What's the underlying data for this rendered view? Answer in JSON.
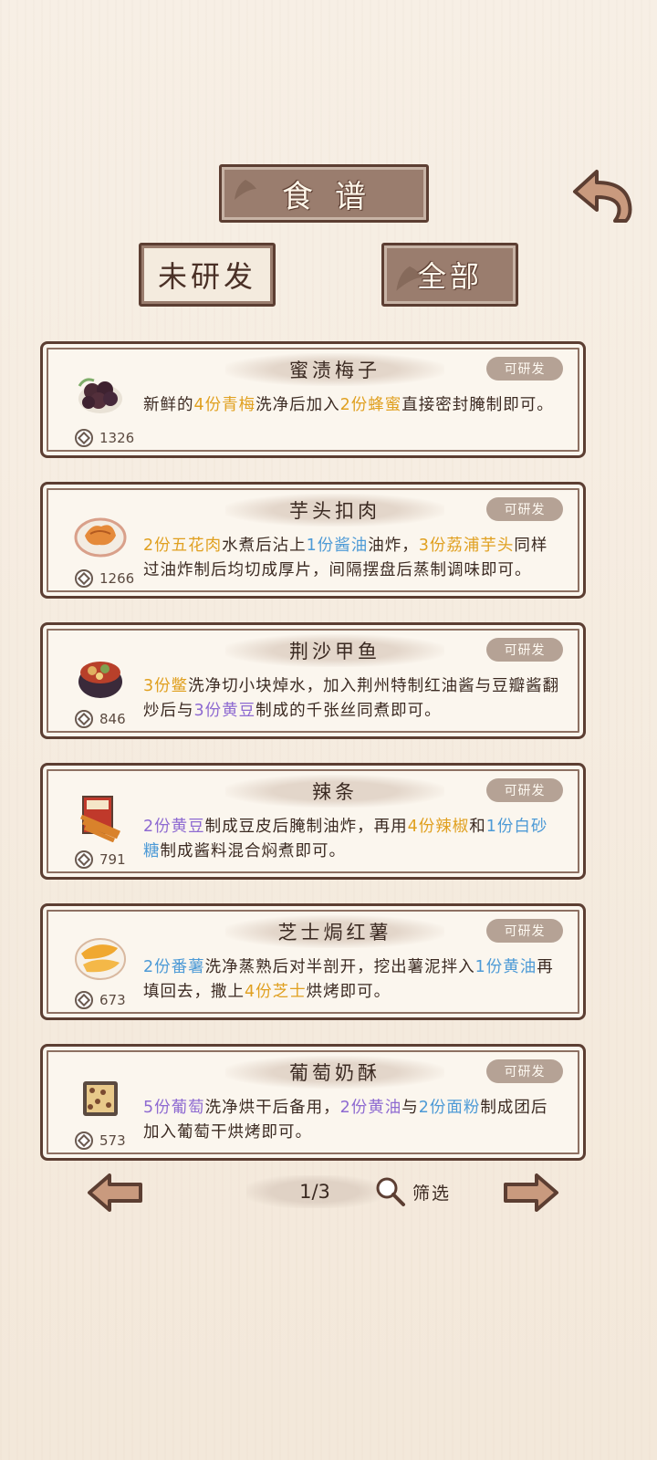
{
  "header": {
    "title": "食谱",
    "back_icon": "back-arrow-icon"
  },
  "tabs": [
    {
      "label": "未研发",
      "selected": false
    },
    {
      "label": "全部",
      "selected": true
    }
  ],
  "recipes": [
    {
      "name": "蜜渍梅子",
      "status": "可研发",
      "cost": "1326",
      "icon": "plum-bowl-icon",
      "desc": [
        {
          "t": "新鲜的"
        },
        {
          "t": "4份青梅",
          "c": "orange"
        },
        {
          "t": "洗净后加入"
        },
        {
          "t": "2份蜂蜜",
          "c": "orange"
        },
        {
          "t": "直接密封腌制即可。"
        }
      ]
    },
    {
      "name": "芋头扣肉",
      "status": "可研发",
      "cost": "1266",
      "icon": "pork-dish-icon",
      "desc": [
        {
          "t": "2份五花肉",
          "c": "orange"
        },
        {
          "t": "水煮后沾上"
        },
        {
          "t": "1份酱油",
          "c": "blue"
        },
        {
          "t": "油炸，"
        },
        {
          "t": "3份荔浦芋头",
          "c": "orange"
        },
        {
          "t": "同样过油炸制后均切成厚片，间隔摆盘后蒸制调味即可。"
        }
      ]
    },
    {
      "name": "荆沙甲鱼",
      "status": "可研发",
      "cost": "846",
      "icon": "turtle-stew-icon",
      "desc": [
        {
          "t": "3份鳖",
          "c": "orange"
        },
        {
          "t": "洗净切小块焯水，加入荆州特制红油酱与豆瓣酱翻炒后与"
        },
        {
          "t": "3份黄豆",
          "c": "purple"
        },
        {
          "t": "制成的千张丝同煮即可。"
        }
      ]
    },
    {
      "name": "辣条",
      "status": "可研发",
      "cost": "791",
      "icon": "spicy-strip-icon",
      "desc": [
        {
          "t": "2份黄豆",
          "c": "purple"
        },
        {
          "t": "制成豆皮后腌制油炸，再用"
        },
        {
          "t": "4份辣椒",
          "c": "orange"
        },
        {
          "t": "和"
        },
        {
          "t": "1份白砂糖",
          "c": "blue"
        },
        {
          "t": "制成酱料混合焖煮即可。"
        }
      ]
    },
    {
      "name": "芝士焗红薯",
      "status": "可研发",
      "cost": "673",
      "icon": "baked-sweet-potato-icon",
      "desc": [
        {
          "t": "2份番薯",
          "c": "blue"
        },
        {
          "t": "洗净蒸熟后对半剖开，挖出薯泥拌入"
        },
        {
          "t": "1份黄油",
          "c": "blue"
        },
        {
          "t": "再填回去，撒上"
        },
        {
          "t": "4份芝士",
          "c": "orange"
        },
        {
          "t": "烘烤即可。"
        }
      ]
    },
    {
      "name": "葡萄奶酥",
      "status": "可研发",
      "cost": "573",
      "icon": "raisin-pastry-icon",
      "desc": [
        {
          "t": "5份葡萄",
          "c": "purple"
        },
        {
          "t": "洗净烘干后备用，"
        },
        {
          "t": "2份黄油",
          "c": "purple"
        },
        {
          "t": "与"
        },
        {
          "t": "2份面粉",
          "c": "blue"
        },
        {
          "t": "制成团后加入葡萄干烘烤即可。"
        }
      ]
    }
  ],
  "pager": {
    "page_label": "1/3",
    "filter_label": "筛选",
    "prev_icon": "left-arrow-icon",
    "next_icon": "right-arrow-icon",
    "filter_icon": "magnifier-icon"
  },
  "colors": {
    "frame": "#5c3e32",
    "plate": "#9a7d6e",
    "badge": "#b5a295",
    "highlight_orange": "#e0a020",
    "highlight_blue": "#4d9ad6",
    "highlight_purple": "#8e6ad1"
  }
}
